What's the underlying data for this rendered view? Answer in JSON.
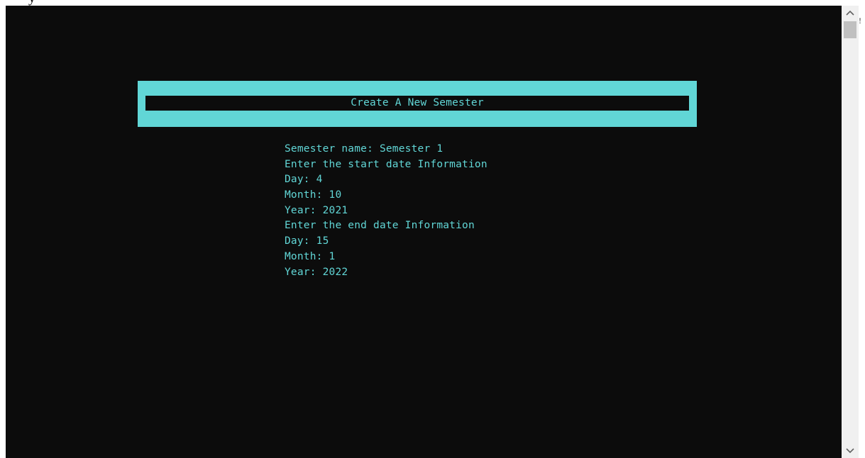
{
  "document": {
    "top_strip_text": "y",
    "right_edge_mark": "!"
  },
  "console": {
    "title": "Create A New Semester",
    "lines": [
      "Semester name: Semester 1",
      "Enter the start date Information",
      "Day: 4",
      "Month: 10",
      "Year: 2021",
      "Enter the end date Information",
      "Day: 15",
      "Month: 1",
      "Year: 2022"
    ]
  },
  "scrollbar": {
    "up_icon": "chevron-up-icon",
    "down_icon": "chevron-down-icon"
  },
  "colors": {
    "console_background": "#0c0c0c",
    "accent_cyan": "#61d6d6",
    "scrollbar_track": "#f0f0f0",
    "scrollbar_thumb": "#c0c0c0"
  }
}
